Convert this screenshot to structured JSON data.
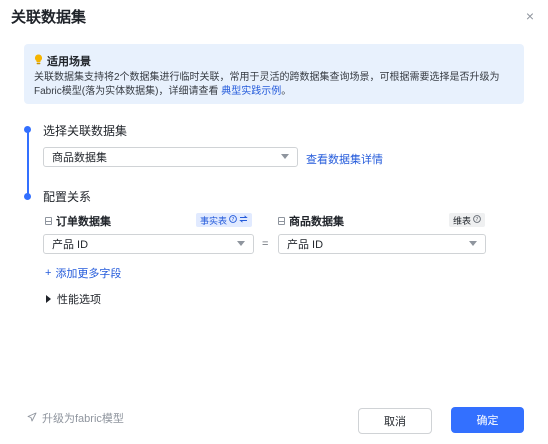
{
  "dialog": {
    "title": "关联数据集",
    "close_label": "×"
  },
  "tip": {
    "icon": "lightbulb-icon",
    "title": "适用场景",
    "body": "关联数据集支持将2个数据集进行临时关联，常用于灵活的跨数据集查询场景，可根据需要选择是否升级为Fabric模型(落为实体数据集)，详细请查看",
    "link": "典型实践示例",
    "end": "。"
  },
  "step1": {
    "label": "选择关联数据集",
    "select_value": "商品数据集",
    "detail_link": "查看数据集详情"
  },
  "step2": {
    "label": "配置关系",
    "left_table": "订单数据集",
    "left_tag": "事实表",
    "right_table": "商品数据集",
    "right_tag": "维表",
    "left_field": "产品 ID",
    "equal": "=",
    "right_field": "产品 ID",
    "add_more": "添加更多字段",
    "perf_options": "性能选项"
  },
  "footer": {
    "upgrade": "升级为fabric模型",
    "cancel": "取消",
    "ok": "确定"
  },
  "colors": {
    "accent": "#3370ff",
    "link": "#245bdb",
    "tip_bg": "#e8f1fd"
  }
}
